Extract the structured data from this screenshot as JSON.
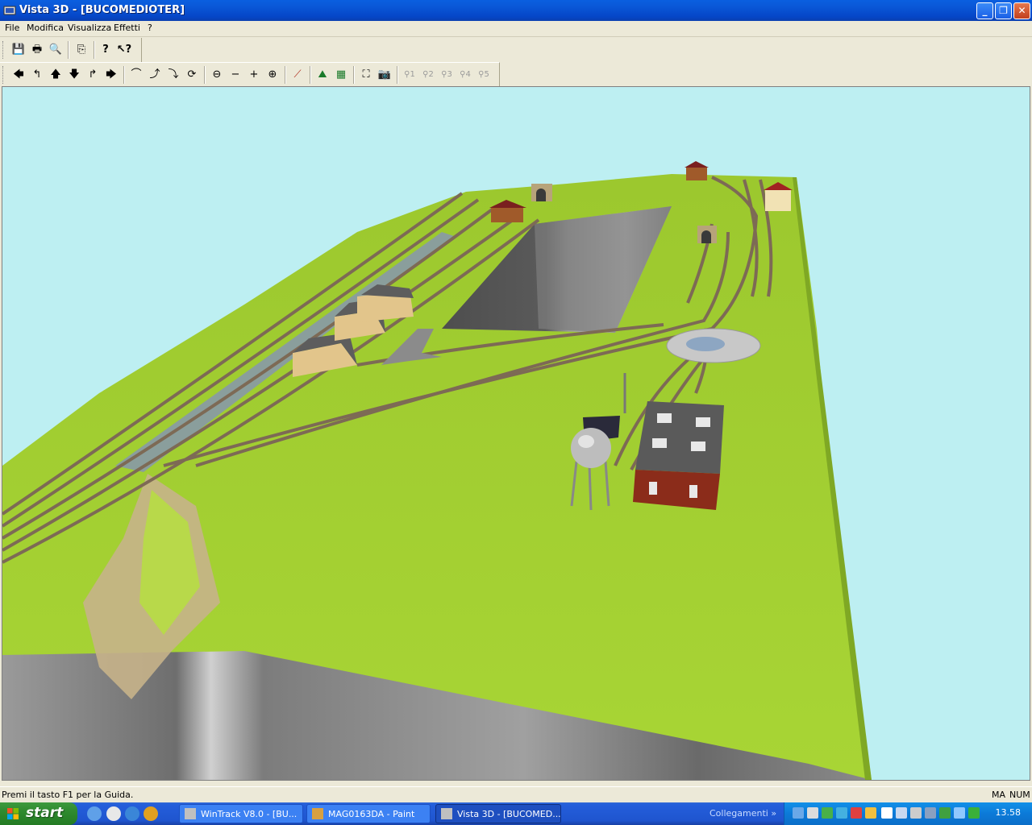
{
  "window": {
    "title": "Vista 3D - [BUCOMEDIOTER]",
    "buttons": {
      "minimize": "_",
      "restore": "❐",
      "close": "✕"
    }
  },
  "menu": [
    "File",
    "Modifica",
    "Visualizza",
    "Effetti",
    "?"
  ],
  "toolbar1": [
    {
      "name": "save-icon",
      "glyph": "💾"
    },
    {
      "name": "print-icon",
      "glyph": "🖶"
    },
    {
      "name": "print-preview-icon",
      "glyph": "🔍"
    },
    {
      "name": "copy-icon",
      "glyph": "⎘"
    },
    {
      "name": "help-icon",
      "glyph": "?"
    },
    {
      "name": "context-help-icon",
      "glyph": "↖?"
    }
  ],
  "toolbar2": {
    "navigation": [
      {
        "name": "arrow-left-icon",
        "glyph": "🡄"
      },
      {
        "name": "turn-left-icon",
        "glyph": "↰"
      },
      {
        "name": "arrow-up-icon",
        "glyph": "🡅"
      },
      {
        "name": "arrow-down-icon",
        "glyph": "🡇"
      },
      {
        "name": "turn-right-icon",
        "glyph": "↱"
      },
      {
        "name": "arrow-right-icon",
        "glyph": "🡆"
      }
    ],
    "camera": [
      {
        "name": "orbit-icon",
        "glyph": "⌒"
      },
      {
        "name": "tilt-up-icon",
        "glyph": "⤴"
      },
      {
        "name": "tilt-down-icon",
        "glyph": "⤵"
      },
      {
        "name": "rotate-icon",
        "glyph": "⟳"
      }
    ],
    "zoom": [
      {
        "name": "zoom-out-icon",
        "glyph": "⊖"
      },
      {
        "name": "zoom-out-small-icon",
        "glyph": "−"
      },
      {
        "name": "zoom-in-small-icon",
        "glyph": "+"
      },
      {
        "name": "zoom-in-icon",
        "glyph": "⊕"
      }
    ],
    "tools": [
      {
        "name": "track-icon",
        "glyph": "⟋"
      },
      {
        "name": "terrain-icon",
        "glyph": "⛰"
      },
      {
        "name": "grid-icon",
        "glyph": "▦"
      }
    ],
    "views": [
      {
        "name": "fit-view-icon",
        "glyph": "⛶"
      },
      {
        "name": "camera-icon",
        "glyph": "📷"
      }
    ],
    "presets": [
      "1",
      "2",
      "3",
      "4",
      "5"
    ]
  },
  "status": {
    "text": "Premi il tasto F1 per la Guida.",
    "indicators": [
      "MA",
      "NUM"
    ]
  },
  "taskbar": {
    "start": "start",
    "tasks": [
      {
        "label": "WinTrack  V8.0 - [BU...",
        "active": false
      },
      {
        "label": "MAG0163DA - Paint",
        "active": false
      },
      {
        "label": "Vista 3D - [BUCOMED...",
        "active": true
      }
    ],
    "links": "Collegamenti",
    "links_chevron": "»",
    "clock": "13.58"
  },
  "colors": {
    "sky": "#bdeff2",
    "grass": "#a6d132",
    "cliff": "#8e8e8e",
    "track": "#7d6a55"
  }
}
